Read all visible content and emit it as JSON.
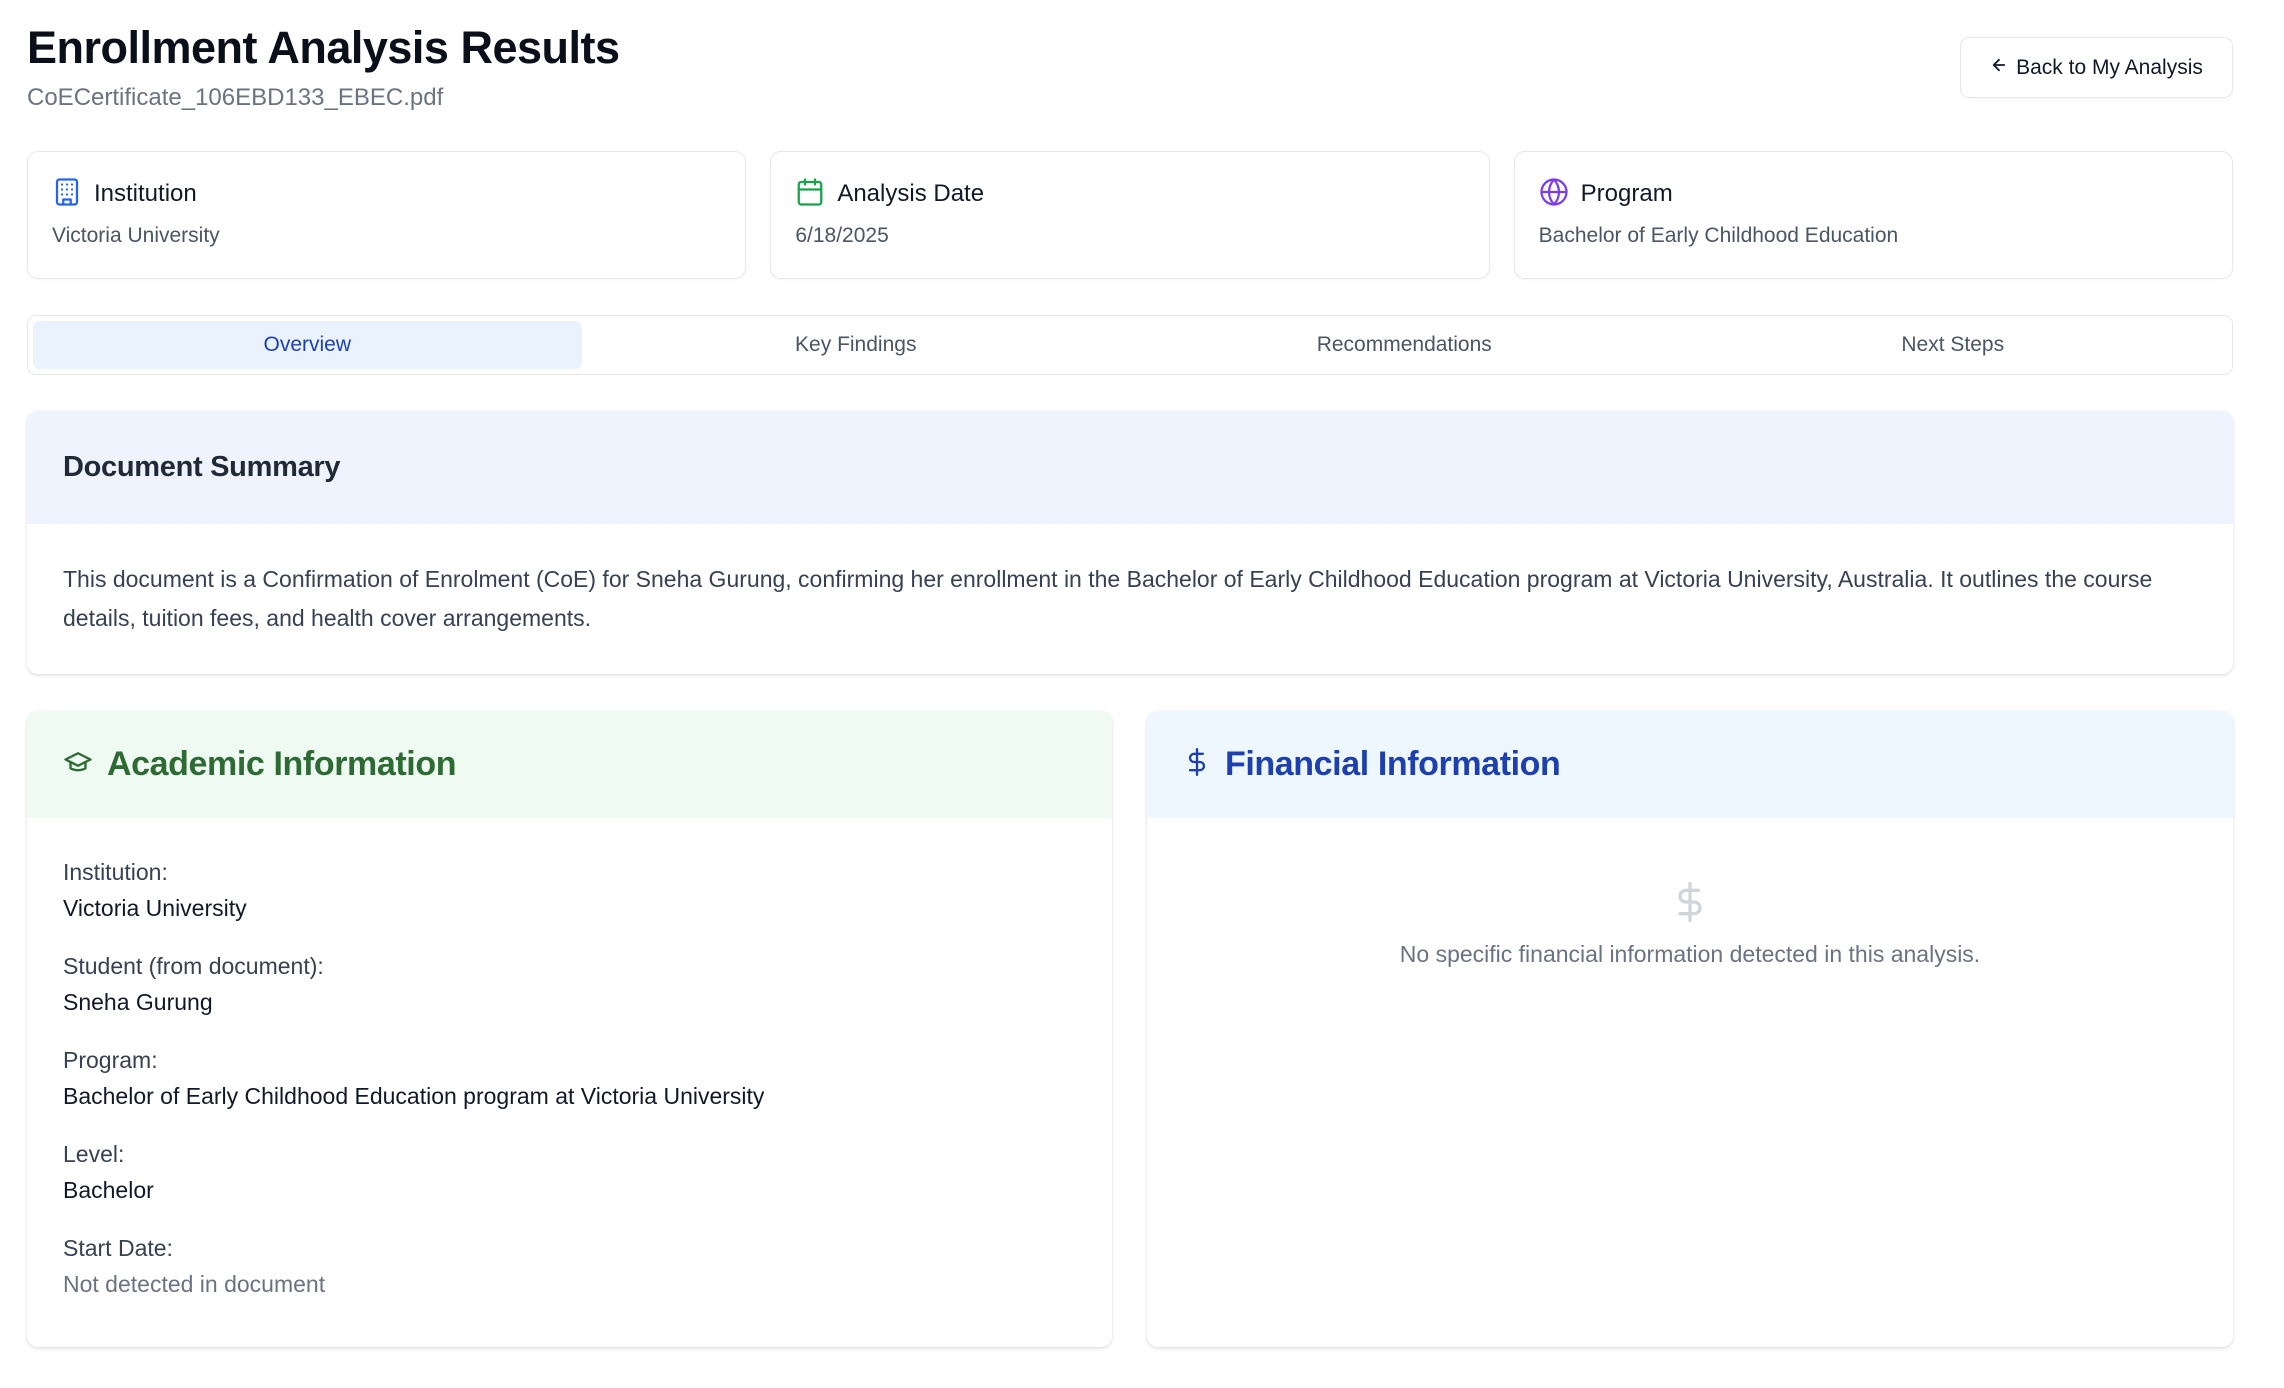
{
  "header": {
    "title": "Enrollment Analysis Results",
    "filename": "CoECertificate_106EBD133_EBEC.pdf",
    "back_label": "Back to My Analysis"
  },
  "info_cards": {
    "institution": {
      "label": "Institution",
      "value": "Victoria University",
      "icon": "building-icon"
    },
    "analysis_date": {
      "label": "Analysis Date",
      "value": "6/18/2025",
      "icon": "calendar-icon"
    },
    "program": {
      "label": "Program",
      "value": "Bachelor of Early Childhood Education",
      "icon": "globe-icon"
    }
  },
  "tabs": [
    {
      "label": "Overview",
      "active": true
    },
    {
      "label": "Key Findings",
      "active": false
    },
    {
      "label": "Recommendations",
      "active": false
    },
    {
      "label": "Next Steps",
      "active": false
    }
  ],
  "summary": {
    "title": "Document Summary",
    "text": "This document is a Confirmation of Enrolment (CoE) for Sneha Gurung, confirming her enrollment in the Bachelor of Early Childhood Education program at Victoria University, Australia. It outlines the course details, tuition fees, and health cover arrangements."
  },
  "academic": {
    "title": "Academic Information",
    "fields": [
      {
        "label": "Institution:",
        "value": "Victoria University"
      },
      {
        "label": "Student (from document):",
        "value": "Sneha Gurung"
      },
      {
        "label": "Program:",
        "value": "Bachelor of Early Childhood Education program at Victoria University"
      },
      {
        "label": "Level:",
        "value": "Bachelor"
      },
      {
        "label": "Start Date:",
        "value": "Not detected in document"
      }
    ]
  },
  "financial": {
    "title": "Financial Information",
    "empty_message": "No specific financial information detected in this analysis."
  },
  "colors": {
    "accent_blue": "#1e40af",
    "accent_green": "#2e6b34",
    "institution_icon": "#2563eb",
    "date_icon": "#16a34a",
    "program_icon": "#7c3aed"
  }
}
